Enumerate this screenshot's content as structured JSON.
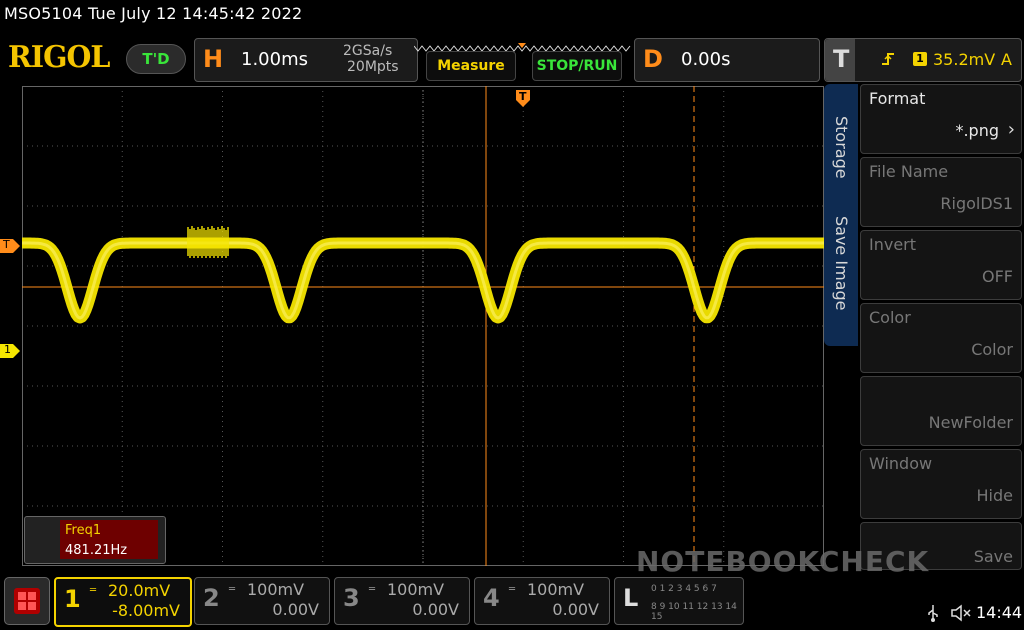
{
  "title_line": "MSO5104  Tue July 12 14:45:42 2022",
  "logo": "RIGOL",
  "header": {
    "mode": "T'D",
    "horizontal": {
      "letter": "H",
      "timebase": "1.00ms",
      "sample_rate": "2GSa/s",
      "memory_depth": "20Mpts"
    },
    "measure_button": "Measure",
    "run_button": "STOP/RUN",
    "delay": {
      "letter": "D",
      "value": "0.00s"
    },
    "trigger": {
      "letter": "T",
      "channel": "1",
      "level": "35.2mV",
      "mode": "A"
    }
  },
  "markers": {
    "trigger_left": "T",
    "channel1_left": "1",
    "trigger_top": "T"
  },
  "menu": {
    "tab_storage": "Storage",
    "tab_save_image": "Save Image",
    "items": [
      {
        "label": "Format",
        "value": "*.png",
        "active": true
      },
      {
        "label": "File Name",
        "value": "RigolDS1",
        "active": false
      },
      {
        "label": "Invert",
        "value": "OFF",
        "active": false
      },
      {
        "label": "Color",
        "value": "Color",
        "active": false
      },
      {
        "label": "",
        "value": "NewFolder",
        "active": false
      },
      {
        "label": "Window",
        "value": "Hide",
        "active": false
      },
      {
        "label": "",
        "value": "Save",
        "active": false
      }
    ]
  },
  "measurement": {
    "name": "Freq1",
    "value": "481.21Hz"
  },
  "channels": [
    {
      "num": "1",
      "scale": "20.0mV",
      "offset": "-8.00mV",
      "active": true
    },
    {
      "num": "2",
      "scale": "100mV",
      "offset": "0.00V",
      "active": false
    },
    {
      "num": "3",
      "scale": "100mV",
      "offset": "0.00V",
      "active": false
    },
    {
      "num": "4",
      "scale": "100mV",
      "offset": "0.00V",
      "active": false
    }
  ],
  "logic": {
    "letter": "L",
    "row1": "0 1 2 3 4 5 6 7",
    "row2": "8 9 10 11 12 13 14 15"
  },
  "status": {
    "time": "14:44"
  },
  "watermark": "NOTEBOOKCHECK",
  "colors": {
    "trace": "#f5e600",
    "cursor": "#ff8c1a",
    "accent": "#f4c400",
    "green": "#39e53a"
  }
}
